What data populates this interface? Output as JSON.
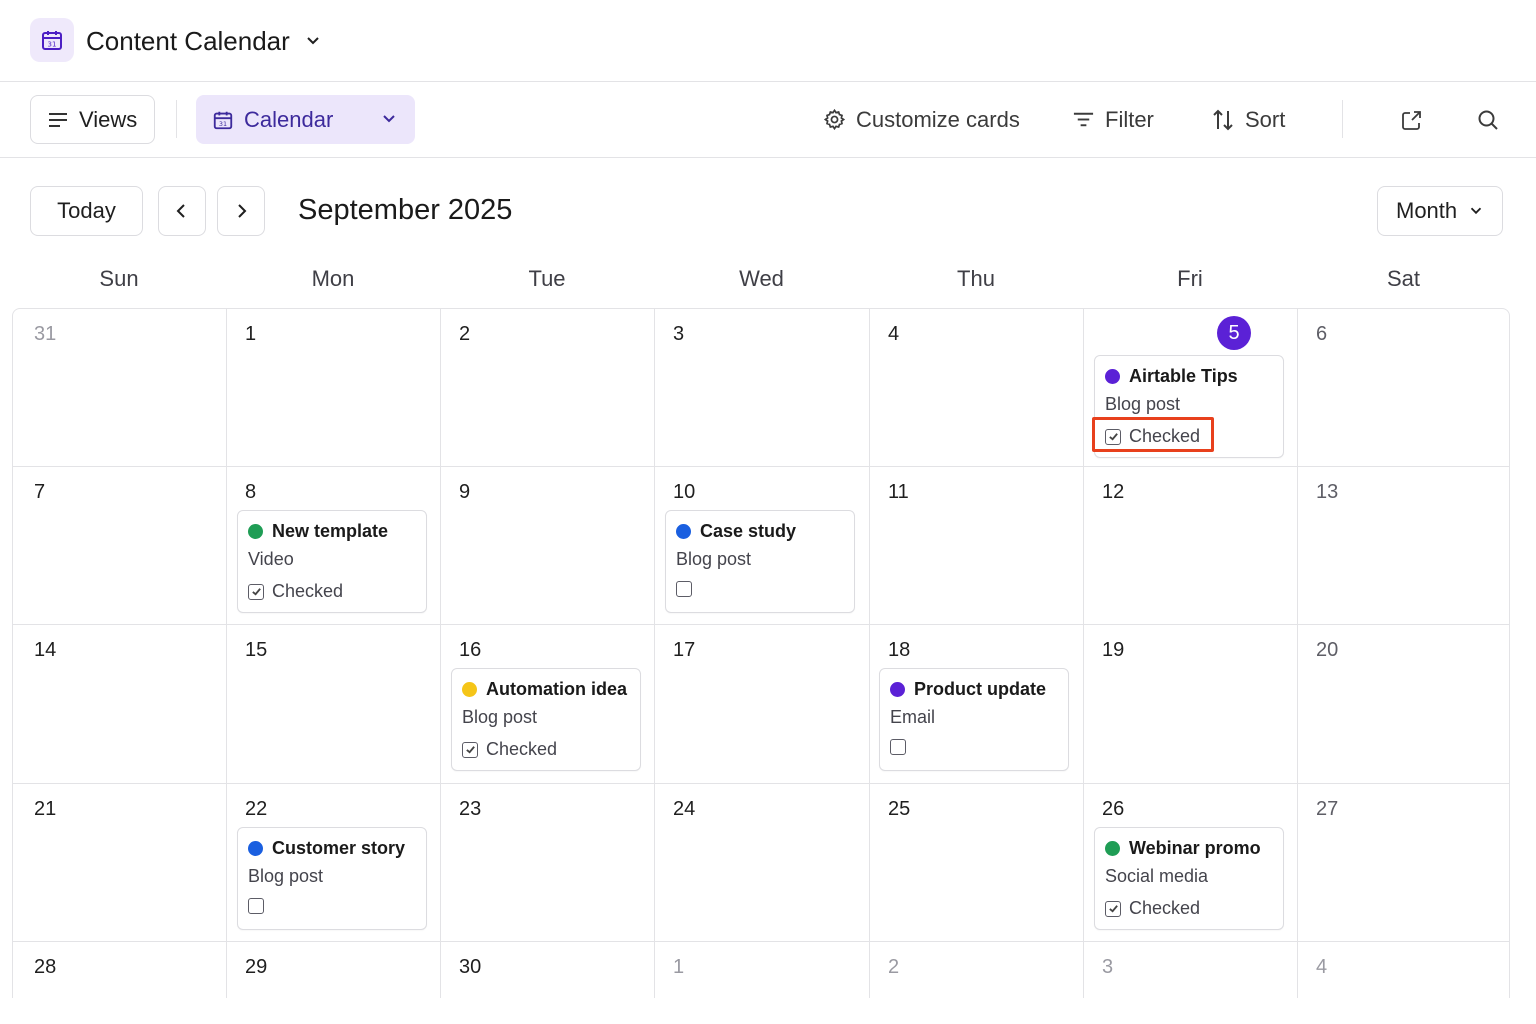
{
  "header": {
    "title": "Content Calendar"
  },
  "toolbar": {
    "views_label": "Views",
    "calendar_label": "Calendar",
    "customize_label": "Customize cards",
    "filter_label": "Filter",
    "sort_label": "Sort"
  },
  "nav": {
    "today_label": "Today",
    "month_title": "September 2025",
    "view_mode": "Month"
  },
  "weekdays": [
    "Sun",
    "Mon",
    "Tue",
    "Wed",
    "Thu",
    "Fri",
    "Sat"
  ],
  "weeks": [
    [
      "31",
      "1",
      "2",
      "3",
      "4",
      "5",
      "6"
    ],
    [
      "7",
      "8",
      "9",
      "10",
      "11",
      "12",
      "13"
    ],
    [
      "14",
      "15",
      "16",
      "17",
      "18",
      "19",
      "20"
    ],
    [
      "21",
      "22",
      "23",
      "24",
      "25",
      "26",
      "27"
    ],
    [
      "28",
      "29",
      "30",
      "1",
      "2",
      "3",
      "4"
    ]
  ],
  "today": "5",
  "events": [
    {
      "title": "Airtable Tips",
      "type": "Blog post",
      "checked": true,
      "check_label": "Checked",
      "color": "#5b21d6"
    },
    {
      "title": "New template",
      "type": "Video",
      "checked": true,
      "check_label": "Checked",
      "color": "#1f9d55"
    },
    {
      "title": "Case study",
      "type": "Blog post",
      "checked": false,
      "check_label": "",
      "color": "#1a5fe0"
    },
    {
      "title": "Automation idea",
      "type": "Blog post",
      "checked": true,
      "check_label": "Checked",
      "color": "#f5c518"
    },
    {
      "title": "Product update",
      "type": "Email",
      "checked": false,
      "check_label": "",
      "color": "#5b21d6"
    },
    {
      "title": "Customer story",
      "type": "Blog post",
      "checked": false,
      "check_label": "",
      "color": "#1a5fe0"
    },
    {
      "title": "Webinar promo",
      "type": "Social media",
      "checked": true,
      "check_label": "Checked",
      "color": "#1f9d55"
    }
  ],
  "colors": {
    "accent": "#5b21d6",
    "highlight": "#e8401c"
  }
}
